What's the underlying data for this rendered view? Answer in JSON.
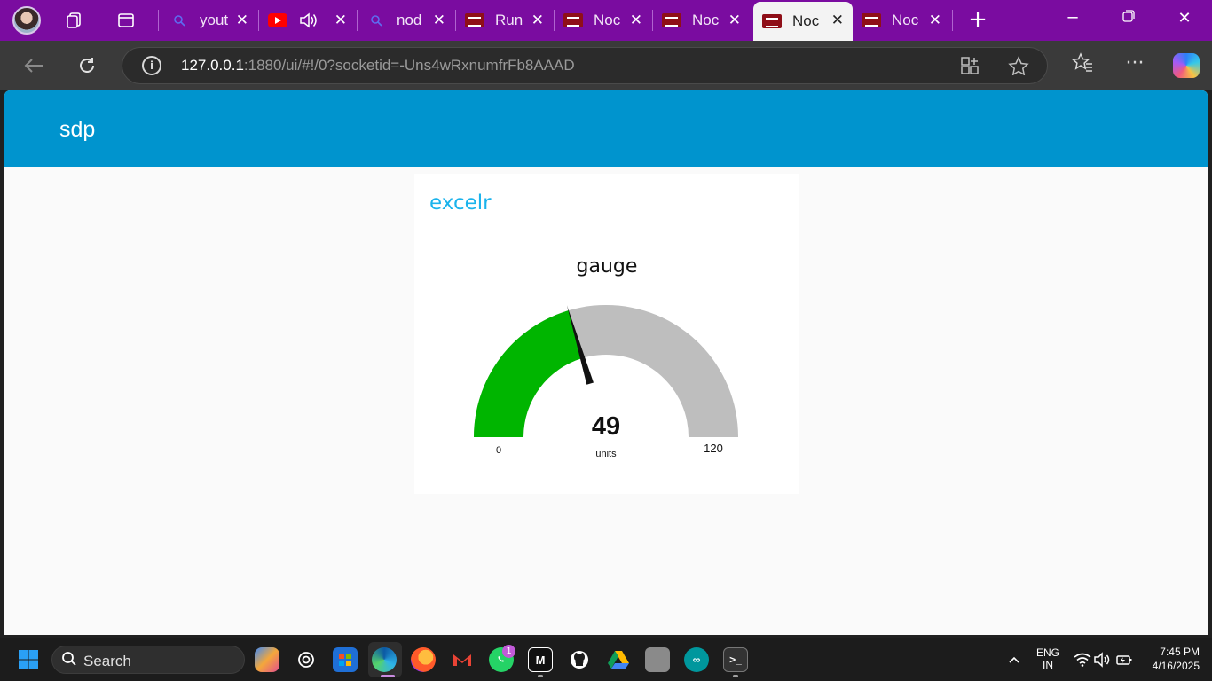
{
  "browser": {
    "tabs": [
      {
        "title": "yout",
        "favicon": "search-icon"
      },
      {
        "title": "",
        "favicon": "youtube-icon"
      },
      {
        "title": "nod",
        "favicon": "search-icon"
      },
      {
        "title": "Run",
        "favicon": "node-red-icon"
      },
      {
        "title": "Noc",
        "favicon": "node-red-icon"
      },
      {
        "title": "Noc",
        "favicon": "node-red-icon"
      },
      {
        "title": "Noc",
        "favicon": "node-red-icon",
        "active": true
      },
      {
        "title": "Noc",
        "favicon": "node-red-icon"
      }
    ],
    "address": {
      "host": "127.0.0.1",
      "rest": ":1880/ui/#!/0?socketid=-Uns4wRxnumfrFb8AAAD"
    }
  },
  "dashboard": {
    "title": "sdp",
    "group_title": "excelr",
    "gauge": {
      "label": "gauge",
      "value": 49,
      "value_text": "49",
      "units": "units",
      "min": 0,
      "max": 120,
      "min_text": "0",
      "max_text": "120",
      "fill_color": "#00b500",
      "track_color": "#bebebe",
      "needle_color": "#111111"
    }
  },
  "taskbar": {
    "search_label": "Search",
    "whatsapp_badge": "1",
    "lang_top": "ENG",
    "lang_bottom": "IN",
    "time": "7:45 PM",
    "date": "4/16/2025"
  }
}
